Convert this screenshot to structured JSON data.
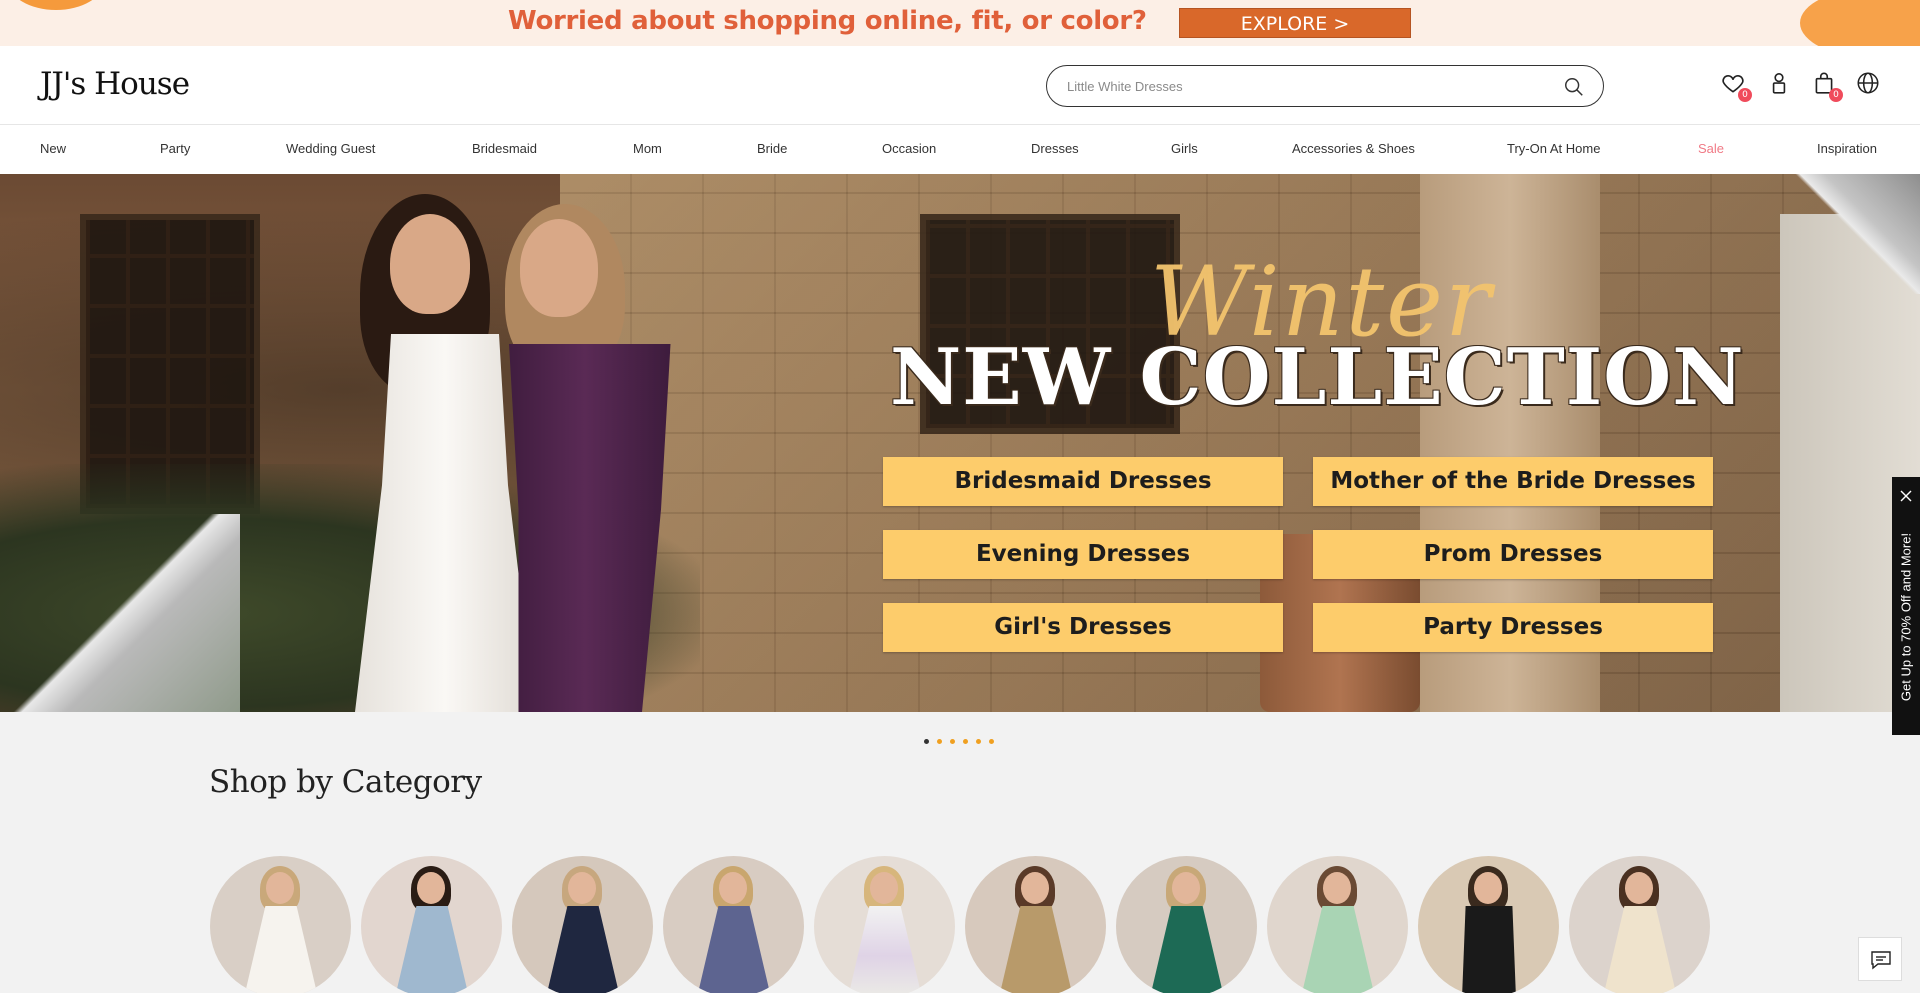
{
  "promo": {
    "text": "Worried about shopping online, fit, or color?",
    "button_label": "EXPLORE >"
  },
  "header": {
    "logo": "JJ's House",
    "search_placeholder": "Little White Dresses",
    "wishlist_count": "0",
    "cart_count": "0",
    "icons": [
      "heart-icon",
      "user-icon",
      "bag-icon",
      "globe-icon"
    ]
  },
  "nav": {
    "items": [
      {
        "label": "New"
      },
      {
        "label": "Party"
      },
      {
        "label": "Wedding Guest"
      },
      {
        "label": "Bridesmaid"
      },
      {
        "label": "Mom"
      },
      {
        "label": "Bride"
      },
      {
        "label": "Occasion"
      },
      {
        "label": "Dresses"
      },
      {
        "label": "Girls"
      },
      {
        "label": "Accessories & Shoes"
      },
      {
        "label": "Try-On At Home"
      },
      {
        "label": "Sale"
      },
      {
        "label": "Inspiration"
      }
    ],
    "sale_color": "#f07a86"
  },
  "hero": {
    "script_text": "Winter",
    "headline": "NEW COLLECTION",
    "buttons": [
      {
        "label": "Bridesmaid Dresses"
      },
      {
        "label": "Mother of the Bride Dresses"
      },
      {
        "label": "Evening Dresses"
      },
      {
        "label": "Prom Dresses"
      },
      {
        "label": "Girl's Dresses"
      },
      {
        "label": "Party Dresses"
      }
    ],
    "button_color": "#fdcc6b"
  },
  "side_tab": {
    "text": "Get Up to 70% Off and More!"
  },
  "carousel": {
    "slide_count": 6,
    "active_index": 0
  },
  "shop_by_category": {
    "title": "Shop by Category",
    "categories": [
      {
        "icon": "white-dress-image"
      },
      {
        "icon": "blue-satin-dress-image"
      },
      {
        "icon": "navy-dress-image"
      },
      {
        "icon": "purple-chiffon-dress-image"
      },
      {
        "icon": "floral-girl-dress-image"
      },
      {
        "icon": "gold-sequin-dress-image"
      },
      {
        "icon": "green-satin-dress-image"
      },
      {
        "icon": "mint-dress-image"
      },
      {
        "icon": "black-suit-image"
      },
      {
        "icon": "maternity-dress-image"
      }
    ]
  }
}
